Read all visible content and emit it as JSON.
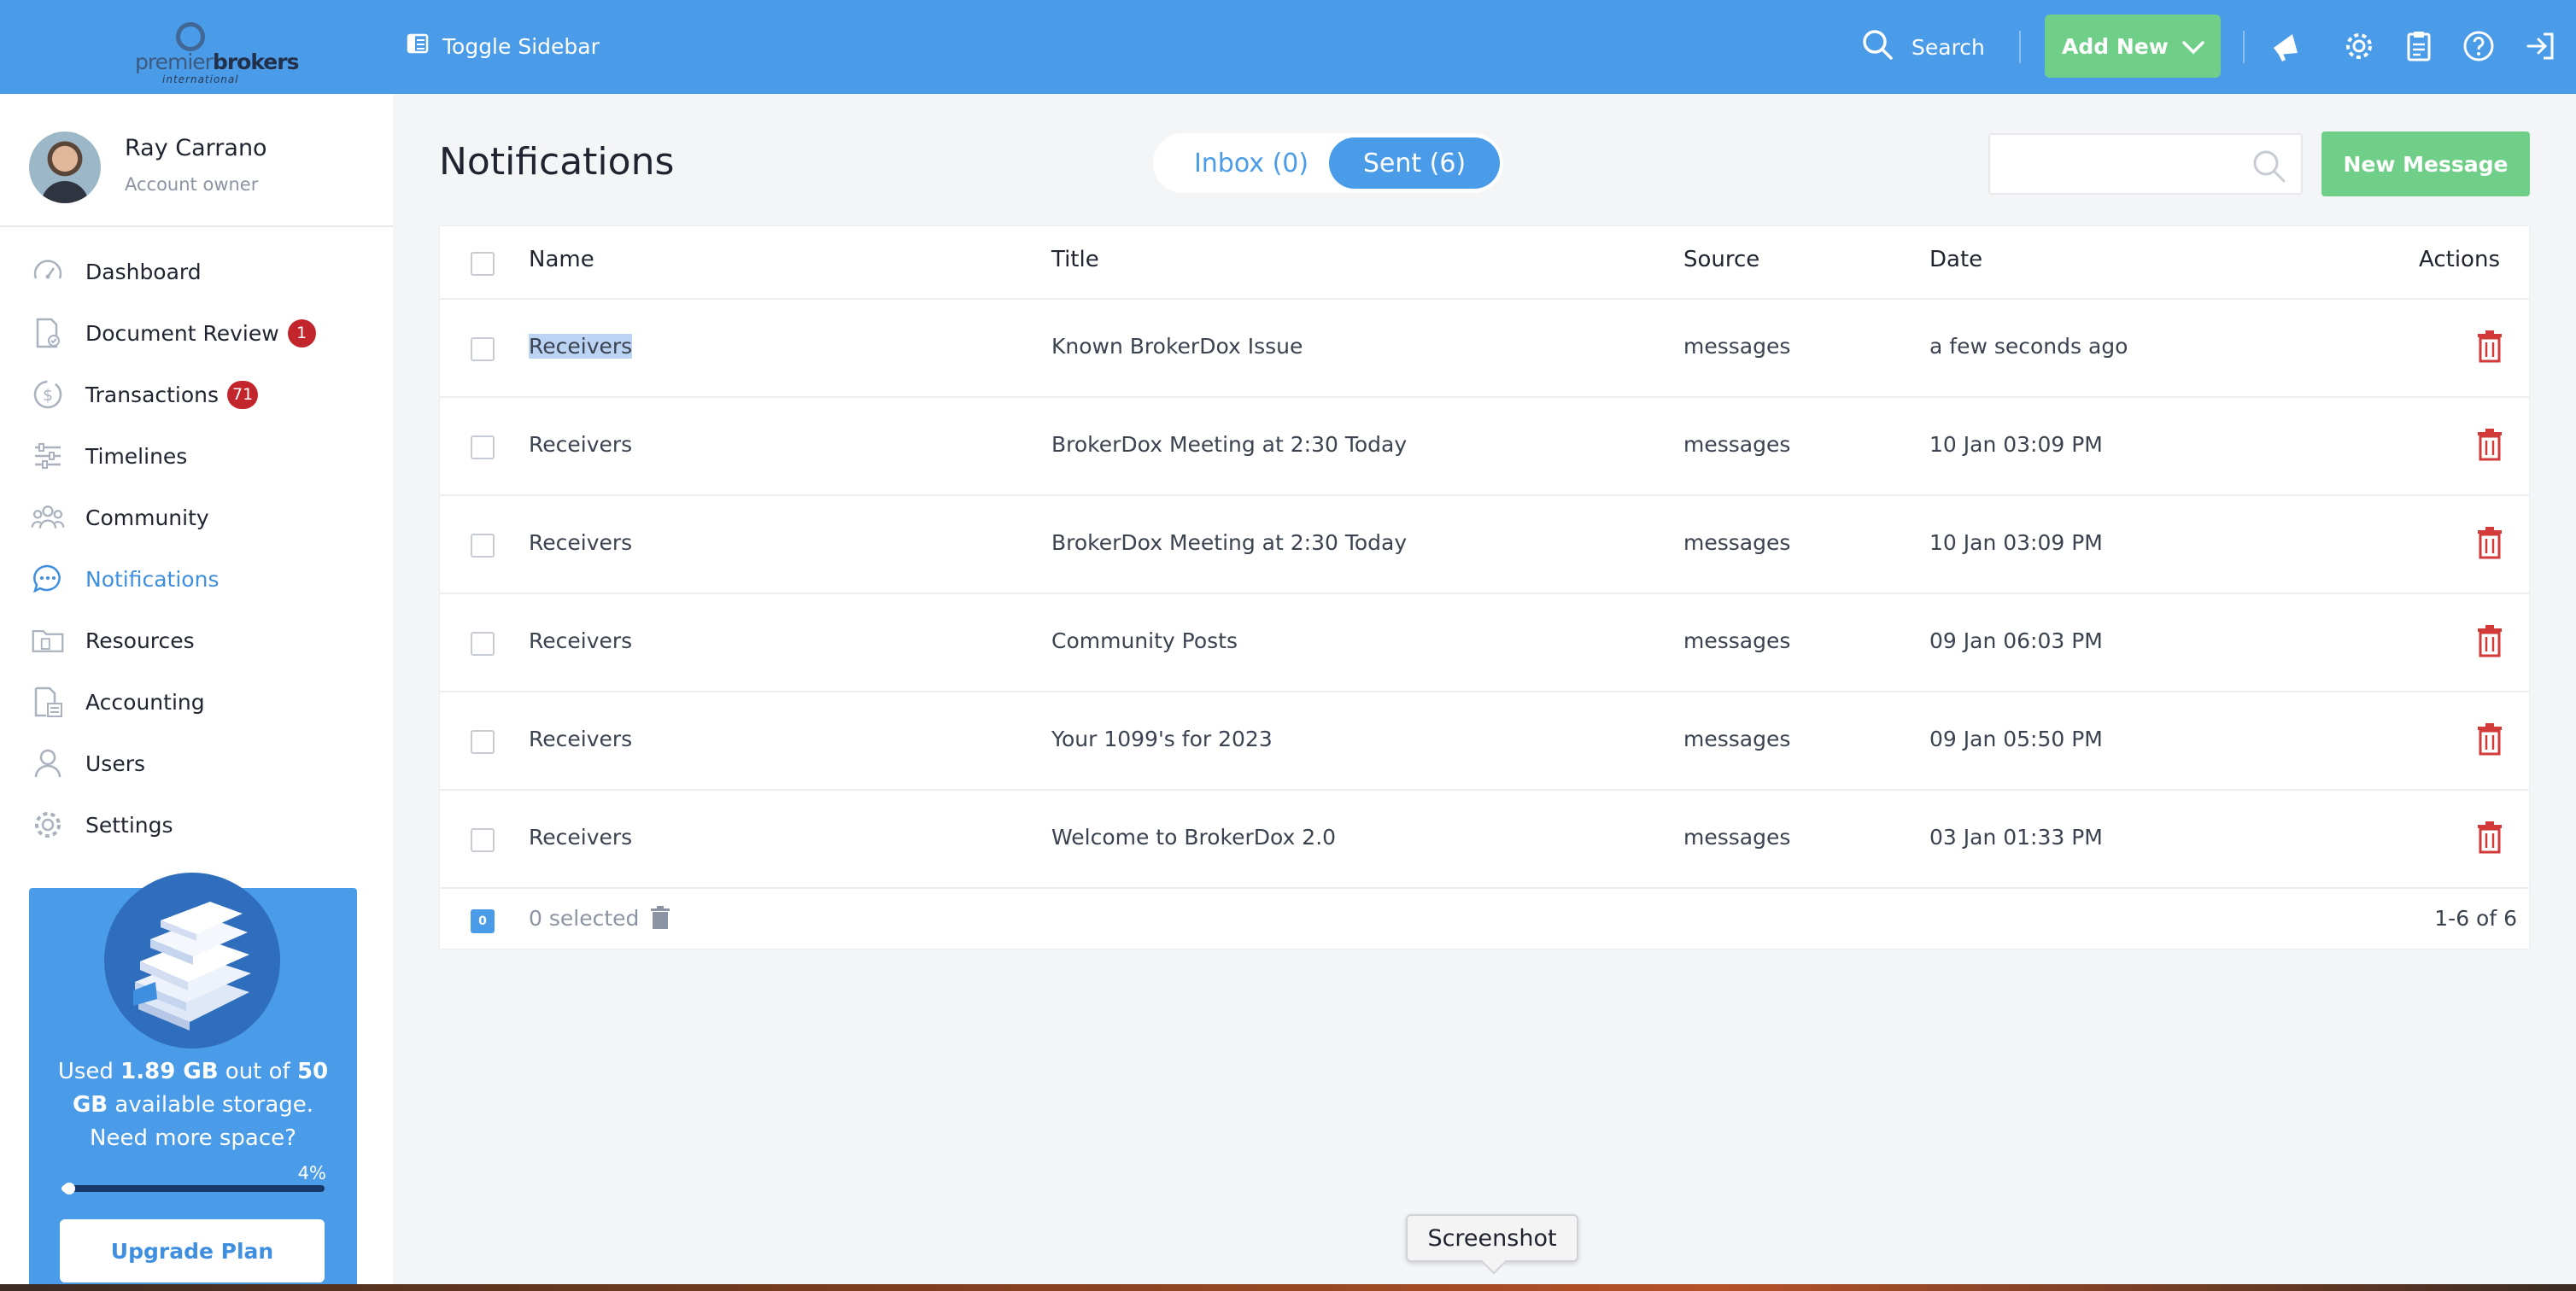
{
  "app": {
    "logo": {
      "brand_prefix": "premier",
      "brand_suffix": "brokers",
      "tagline": "international"
    },
    "header": {
      "toggle_sidebar_label": "Toggle Sidebar",
      "search_label": "Search",
      "add_new_label": "Add New",
      "icons": [
        "megaphone-icon",
        "gear-icon",
        "clipboard-icon",
        "help-icon",
        "logout-icon"
      ]
    },
    "accent_color": "#4a9be8",
    "success_color": "#6fcf88",
    "danger_color": "#c2252b"
  },
  "sidebar": {
    "profile": {
      "name": "Ray Carrano",
      "role": "Account owner"
    },
    "items": [
      {
        "label": "Dashboard",
        "icon": "gauge-icon",
        "badge": ""
      },
      {
        "label": "Document Review",
        "icon": "document-check-icon",
        "badge": "1"
      },
      {
        "label": "Transactions",
        "icon": "dollar-icon",
        "badge": "71"
      },
      {
        "label": "Timelines",
        "icon": "sliders-icon",
        "badge": ""
      },
      {
        "label": "Community",
        "icon": "people-icon",
        "badge": ""
      },
      {
        "label": "Notifications",
        "icon": "chat-bubble-icon",
        "badge": "",
        "active": true
      },
      {
        "label": "Resources",
        "icon": "folder-icon",
        "badge": ""
      },
      {
        "label": "Accounting",
        "icon": "calculator-icon",
        "badge": ""
      },
      {
        "label": "Users",
        "icon": "user-icon",
        "badge": ""
      },
      {
        "label": "Settings",
        "icon": "gear-icon",
        "badge": ""
      }
    ],
    "storage": {
      "text_used": "Used ",
      "used": "1.89 GB",
      "text_outof": " out of ",
      "total_num": "50",
      "total_unit": "GB",
      "text_available": " available storage.",
      "text_more": "Need more space?",
      "percent_label": "4%",
      "percent_value": 0.04,
      "upgrade_label": "Upgrade Plan"
    }
  },
  "main": {
    "title": "Notifications",
    "tabs": {
      "inbox": "Inbox (0)",
      "sent": "Sent (6)"
    },
    "search_placeholder": "",
    "new_message_label": "New Message",
    "table": {
      "columns": {
        "name": "Name",
        "title": "Title",
        "source": "Source",
        "date": "Date",
        "actions": "Actions"
      },
      "rows": [
        {
          "name": "Receivers",
          "title": "Known BrokerDox Issue",
          "source": "messages",
          "date": "a few seconds ago"
        },
        {
          "name": "Receivers",
          "title": "BrokerDox Meeting at 2:30 Today",
          "source": "messages",
          "date": "10 Jan 03:09 PM"
        },
        {
          "name": "Receivers",
          "title": "BrokerDox Meeting at 2:30 Today",
          "source": "messages",
          "date": "10 Jan 03:09 PM"
        },
        {
          "name": "Receivers",
          "title": "Community Posts",
          "source": "messages",
          "date": "09 Jan 06:03 PM"
        },
        {
          "name": "Receivers",
          "title": "Your 1099's for 2023",
          "source": "messages",
          "date": "09 Jan 05:50 PM"
        },
        {
          "name": "Receivers",
          "title": "Welcome to BrokerDox 2.0",
          "source": "messages",
          "date": "03 Jan 01:33 PM"
        }
      ],
      "footer": {
        "selected_count": "0",
        "selected_label": "0 selected",
        "pagination": "1-6 of 6"
      }
    }
  },
  "tooltip": {
    "label": "Screenshot"
  }
}
